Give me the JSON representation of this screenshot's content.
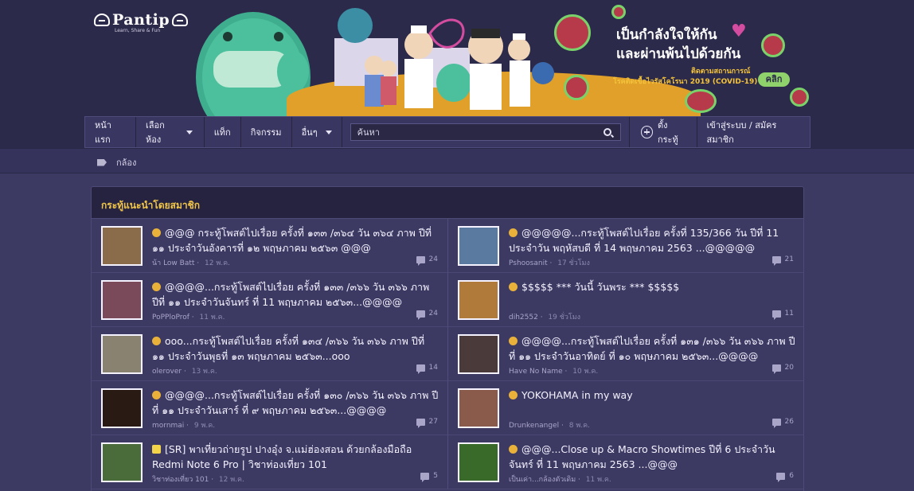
{
  "brand": {
    "name": "Pantip",
    "tagline": "Learn, Share & Fun"
  },
  "banner": {
    "headline_1": "เป็นกำลังใจให้กัน",
    "headline_2": "และผ่านพ้นไปด้วยกัน",
    "sub_1": "ติดตามสถานการณ์",
    "sub_2": "โรคติดเชื้อไวรัสโคโรนา 2019 (COVID-19)",
    "cta": "คลิก"
  },
  "nav": {
    "home": "หน้าแรก",
    "choose_room": "เลือกห้อง",
    "tag": "แท็ก",
    "activity": "กิจกรรม",
    "more": "อื่นๆ",
    "search_placeholder": "ค้นหา",
    "new_topic": "ตั้งกระทู้",
    "login": "เข้าสู่ระบบ / สมัครสมาชิก"
  },
  "breadcrumb": {
    "label": "กล้อง"
  },
  "panel": {
    "heading": "กระทู้แนะนำโดยสมาชิก",
    "left": [
      {
        "title": "@@@ กระทู้โพสต์ไปเรื่อย ครั้งที่ ๑๓๓ /๓๖๔ วัน ๓๖๔ ภาพ ปีที่ ๑๑ ประจำวันอังคารที่ ๑๒ พฤษภาคม ๒๕๖๓ @@@",
        "author": "น้า Low Batt",
        "time": "12 พ.ค.",
        "comments": "24"
      },
      {
        "title": "@@@@...กระทู้โพสต์ไปเรื่อย ครั้งที่ ๑๓๓ /๓๖๖ วัน ๓๖๖ ภาพ ปีที่ ๑๑ ประจำวันจันทร์ ที่ 11 พฤษภาคม ๒๕๖๓...@@@@",
        "author": "PoPPloProf",
        "time": "11 พ.ค.",
        "comments": "24"
      },
      {
        "title": "ooo...กระทู้โพสต์ไปเรื่อย ครั้งที่ ๑๓๔ /๓๖๖ วัน ๓๖๖ ภาพ ปีที่ ๑๑ ประจำวันพุธที่ ๑๓ พฤษภาคม ๒๕๖๓...ooo",
        "author": "olerover",
        "time": "13 พ.ค.",
        "comments": "14"
      },
      {
        "title": "@@@@...กระทู้โพสต์ไปเรื่อย ครั้งที่ ๑๓๐ /๓๖๖ วัน ๓๖๖ ภาพ ปีที่ ๑๑ ประจำวันเสาร์ ที่ ๙ พฤษภาคม ๒๕๖๓...@@@@",
        "author": "mornmai",
        "time": "9 พ.ค.",
        "comments": "27"
      },
      {
        "title": "[SR] พาเที่ยวถ่ายรูป ปางอุ๋ง จ.แม่ฮ่องสอน ด้วยกล้องมือถือ Redmi Note 6 Pro | วิชาท่องเที่ยว 101",
        "author": "วิชาท่องเที่ยว 101",
        "time": "12 พ.ค.",
        "comments": "5"
      }
    ],
    "right": [
      {
        "title": "@@@@@...กระทู้โพสต์ไปเรื่อย ครั้งที่ 135/366 วัน ปีที่ 11 ประจำวัน พฤหัสบดี ที่ 14 พฤษภาคม 2563 ...@@@@@",
        "author": "Pshoosanit",
        "time": "17 ชั่วโมง",
        "comments": "21"
      },
      {
        "title": "$$$$$ *** วันนี้ วันพระ *** $$$$$",
        "author": "dih2552",
        "time": "19 ชั่วโมง",
        "comments": "11"
      },
      {
        "title": "@@@@...กระทู้โพสต์ไปเรื่อย ครั้งที่ ๑๓๑ /๓๖๖ วัน ๓๖๖ ภาพ ปีที่ ๑๑ ประจำวันอาทิตย์ ที่ ๑๐ พฤษภาคม ๒๕๖๓...@@@@",
        "author": "Have No Name",
        "time": "10 พ.ค.",
        "comments": "20"
      },
      {
        "title": "YOKOHAMA in my way",
        "author": "Drunkenangel",
        "time": "8 พ.ค.",
        "comments": "26"
      },
      {
        "title": "@@@...Close up & Macro Showtimes ปีที่ 6 ประจำวันจันทร์ ที่ 11 พฤษภาคม 2563 ...@@@",
        "author": "เป็นเค่า...กล้องตัวเดิม",
        "time": "11 พ.ค.",
        "comments": "6"
      }
    ]
  },
  "colors": {
    "page_bg": "#3c3963",
    "header_bg": "#2c2a4a",
    "panel_head_text": "#f2c64a"
  },
  "thumb_colors": {
    "left": [
      "#8a6b4a",
      "#7a4a5a",
      "#8a8270",
      "#2a1a14",
      "#4a6b3a"
    ],
    "right": [
      "#5a7aa0",
      "#b07a3a",
      "#4a3a3a",
      "#8a5a4a",
      "#3a6a2a"
    ]
  }
}
